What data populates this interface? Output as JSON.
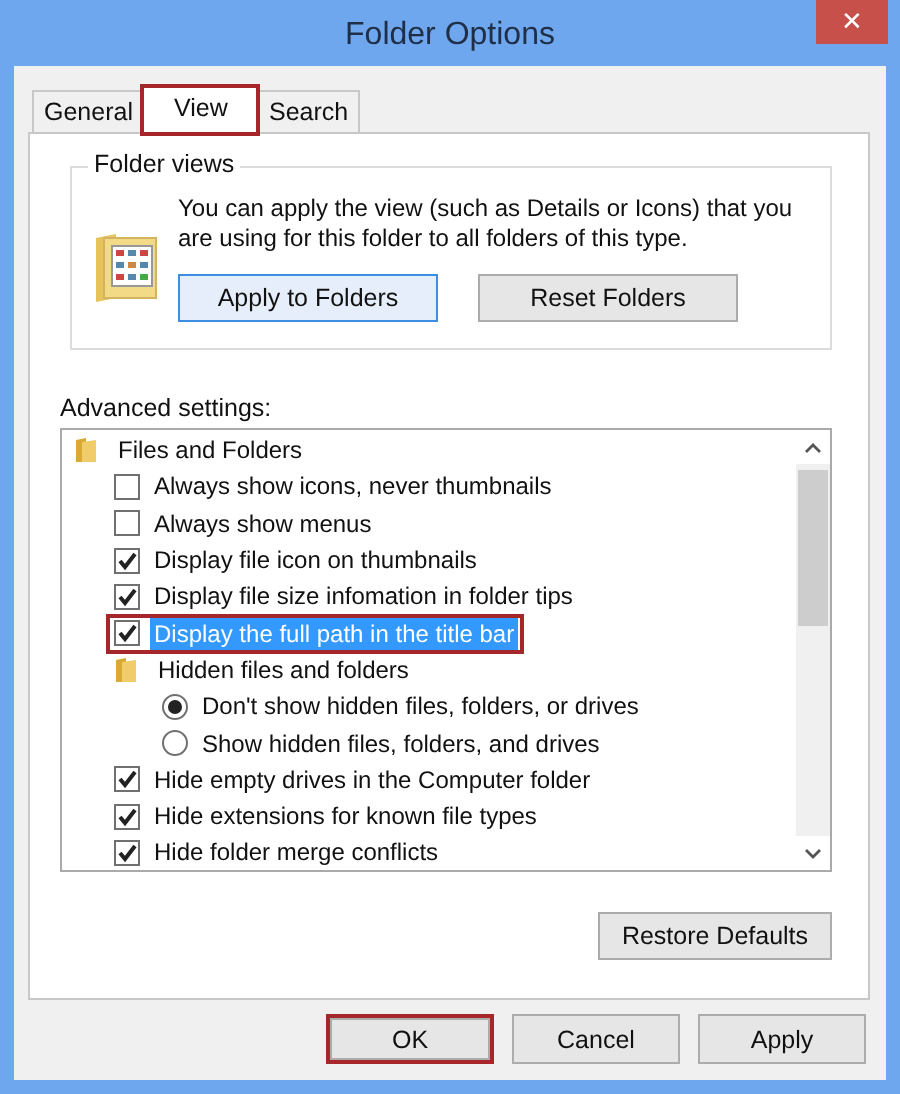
{
  "window": {
    "title": "Folder Options",
    "close": "✕"
  },
  "tabs": [
    {
      "label": "General",
      "selected": false,
      "annotated": false
    },
    {
      "label": "View",
      "selected": true,
      "annotated": true
    },
    {
      "label": "Search",
      "selected": false,
      "annotated": false
    }
  ],
  "folder_views": {
    "legend": "Folder views",
    "text": "You can apply the view (such as Details or Icons) that you are using for this folder to all folders of this type.",
    "buttons": [
      {
        "label": "Apply to Folders",
        "focused": true
      },
      {
        "label": "Reset Folders",
        "focused": false
      }
    ]
  },
  "advanced": {
    "label": "Advanced settings:",
    "items": [
      {
        "kind": "folder",
        "label": "Files and Folders",
        "selected": false,
        "annotated": false,
        "children": [
          {
            "kind": "checkbox",
            "label": "Always show icons, never thumbnails",
            "checked": false,
            "selected": false,
            "annotated": false
          },
          {
            "kind": "checkbox",
            "label": "Always show menus",
            "checked": false,
            "selected": false,
            "annotated": false
          },
          {
            "kind": "checkbox",
            "label": "Display file icon on thumbnails",
            "checked": true,
            "selected": false,
            "annotated": false
          },
          {
            "kind": "checkbox",
            "label": "Display file size infomation in folder tips",
            "checked": true,
            "selected": false,
            "annotated": false
          },
          {
            "kind": "checkbox",
            "label": "Display the full path in the title bar",
            "checked": true,
            "selected": true,
            "annotated": true
          },
          {
            "kind": "folder",
            "label": "Hidden files and folders",
            "selected": false,
            "annotated": false,
            "children": [
              {
                "kind": "radio",
                "label": "Don't show hidden files, folders, or drives",
                "checked": true,
                "selected": false,
                "annotated": false
              },
              {
                "kind": "radio",
                "label": "Show hidden files, folders, and drives",
                "checked": false,
                "selected": false,
                "annotated": false
              }
            ]
          },
          {
            "kind": "checkbox",
            "label": "Hide empty drives in the Computer folder",
            "checked": true,
            "selected": false,
            "annotated": false
          },
          {
            "kind": "checkbox",
            "label": "Hide extensions for known file types",
            "checked": true,
            "selected": false,
            "annotated": false
          },
          {
            "kind": "checkbox",
            "label": "Hide folder merge conflicts",
            "checked": true,
            "selected": false,
            "annotated": false
          }
        ]
      }
    ],
    "restore_button": "Restore Defaults"
  },
  "buttons": [
    {
      "label": "OK",
      "annotated": true
    },
    {
      "label": "Cancel",
      "annotated": false
    },
    {
      "label": "Apply",
      "annotated": false
    }
  ]
}
